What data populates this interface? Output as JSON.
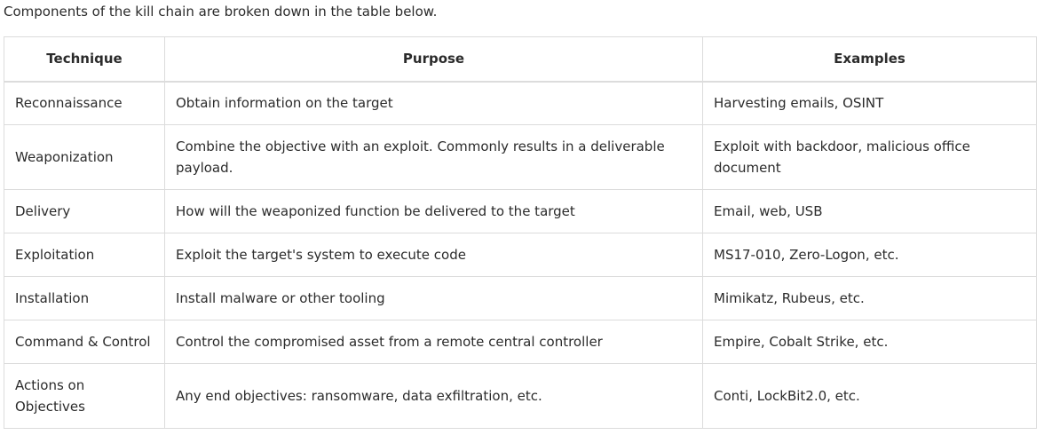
{
  "intro": "Components of the kill chain are broken down in the table below.",
  "table": {
    "headers": [
      "Technique",
      "Purpose",
      "Examples"
    ],
    "rows": [
      {
        "technique": "Reconnaissance",
        "purpose": "Obtain information on the target",
        "examples": "Harvesting emails, OSINT"
      },
      {
        "technique": "Weaponization",
        "purpose": "Combine the objective with an exploit. Commonly results in a deliverable payload.",
        "examples": "Exploit with backdoor, malicious office document"
      },
      {
        "technique": "Delivery",
        "purpose": "How will the weaponized function be delivered to the target",
        "examples": "Email, web, USB"
      },
      {
        "technique": "Exploitation",
        "purpose": "Exploit the target's system to execute code",
        "examples": "MS17-010, Zero-Logon, etc."
      },
      {
        "technique": "Installation",
        "purpose": "Install malware or other tooling",
        "examples": "Mimikatz, Rubeus, etc."
      },
      {
        "technique": "Command & Control",
        "purpose": "Control the compromised asset from a remote central controller",
        "examples": "Empire, Cobalt Strike, etc."
      },
      {
        "technique": "Actions on Objectives",
        "purpose": "Any end objectives: ransomware, data exfiltration, etc.",
        "examples": "Conti, LockBit2.0, etc."
      }
    ]
  }
}
